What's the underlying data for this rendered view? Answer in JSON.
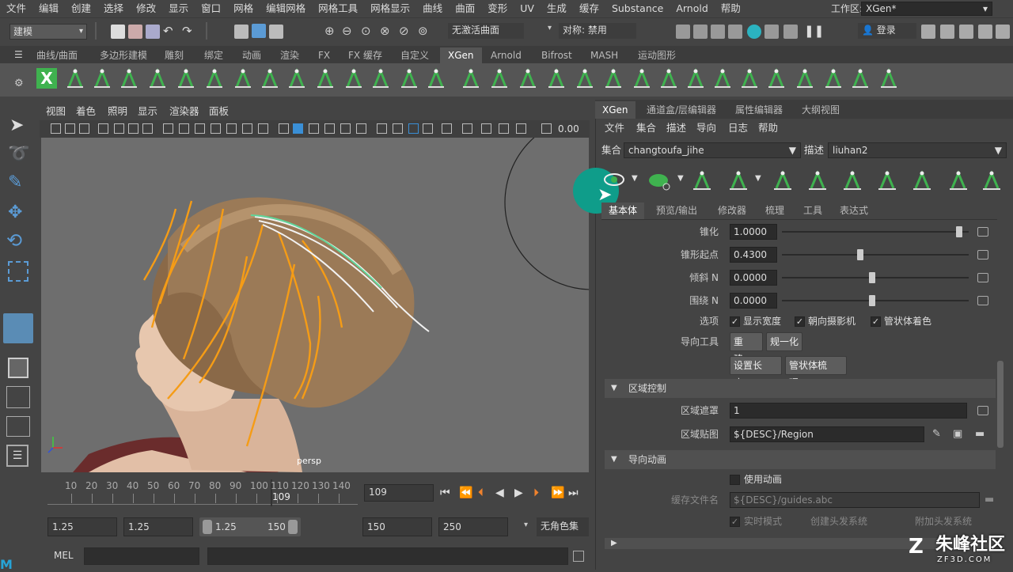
{
  "menubar": {
    "items": [
      "文件",
      "编辑",
      "创建",
      "选择",
      "修改",
      "显示",
      "窗口",
      "网格",
      "编辑网格",
      "网格工具",
      "网格显示",
      "曲线",
      "曲面",
      "变形",
      "UV",
      "生成",
      "缓存",
      "Substance",
      "Arnold",
      "帮助"
    ],
    "workspace_label": "工作区:",
    "workspace_value": "XGen*"
  },
  "statusline": {
    "mode": "建模",
    "live_surface": "无激活曲面",
    "symmetry": "对称: 禁用",
    "login": "登录"
  },
  "shelf": {
    "tabs": [
      "曲线/曲面",
      "多边形建模",
      "雕刻",
      "绑定",
      "动画",
      "渲染",
      "FX",
      "FX 缓存",
      "自定义",
      "XGen",
      "Arnold",
      "Bifrost",
      "MASH",
      "运动图形"
    ],
    "active_tab": "XGen"
  },
  "viewport": {
    "menu": [
      "视图",
      "着色",
      "照明",
      "显示",
      "渲染器",
      "面板"
    ],
    "field_value": "0.00",
    "camera_label": "persp"
  },
  "timeline": {
    "ticks": [
      "10",
      "20",
      "30",
      "40",
      "50",
      "60",
      "70",
      "80",
      "90",
      "100",
      "110",
      "120",
      "130",
      "140"
    ],
    "current_frame": "109",
    "frame_field": "109"
  },
  "range": {
    "start": "1.25",
    "anim_start": "1.25",
    "slider_start": "1.25",
    "slider_end": "150",
    "anim_end": "150",
    "end": "250",
    "character_set": "无角色集"
  },
  "mel": {
    "label": "MEL"
  },
  "panel": {
    "tabs": [
      "XGen",
      "通道盒/层编辑器",
      "属性编辑器",
      "大纲视图"
    ],
    "active_tab": "XGen",
    "menu": [
      "文件",
      "集合",
      "描述",
      "导向",
      "日志",
      "帮助"
    ],
    "collection_label": "集合",
    "collection_value": "changtoufa_jihe",
    "description_label": "描述",
    "description_value": "liuhan2",
    "subtabs": [
      "基本体",
      "预览/输出",
      "修改器",
      "梳理",
      "工具",
      "表达式"
    ],
    "active_subtab": "基本体",
    "params": [
      {
        "label": "锥化",
        "value": "1.0000",
        "fraction": 1.0
      },
      {
        "label": "锥形起点",
        "value": "0.4300",
        "fraction": 0.43
      },
      {
        "label": "倾斜 N",
        "value": "0.0000",
        "fraction": 0.5
      },
      {
        "label": "围绕 N",
        "value": "0.0000",
        "fraction": 0.5
      }
    ],
    "options_label": "选项",
    "options": [
      {
        "label": "显示宽度",
        "checked": true
      },
      {
        "label": "朝向摄影机",
        "checked": true
      },
      {
        "label": "管状体着色",
        "checked": true
      }
    ],
    "guide_tools_label": "导向工具",
    "guide_buttons": [
      "重建...",
      "规一化",
      "设置长度...",
      "管状体梳理..."
    ],
    "region_section": "区域控制",
    "region_mask_label": "区域遮罩",
    "region_mask_value": "1",
    "region_map_label": "区域贴图",
    "region_map_value": "${DESC}/Region",
    "guide_anim_section": "导向动画",
    "use_anim_label": "使用动画",
    "cache_label": "缓存文件名",
    "cache_value": "${DESC}/guides.abc",
    "live_mode_label": "实时模式",
    "create_hair_label": "创建头发系统",
    "attach_hair_label": "附加头发系统"
  },
  "watermark": {
    "text": "朱峰社区",
    "url": "ZF3D.COM"
  },
  "colors": {
    "accent_green": "#3fb24f",
    "teal_highlight": "#0f9d8a",
    "viewport_bg": "#6e6e6e",
    "guide_orange": "#f59c16"
  }
}
